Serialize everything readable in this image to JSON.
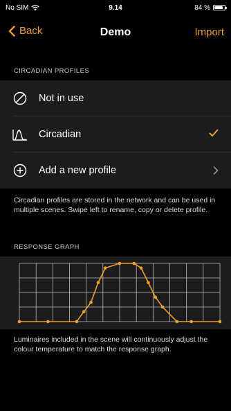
{
  "status": {
    "carrier": "No SIM",
    "time": "9.14",
    "battery_percent": "84 %",
    "battery_level": 0.84
  },
  "nav": {
    "back_label": "Back",
    "title": "Demo",
    "action_label": "Import"
  },
  "profiles": {
    "header": "CIRCADIAN PROFILES",
    "items": [
      {
        "label": "Not in use",
        "icon": "not-in-use-icon",
        "selected": false
      },
      {
        "label": "Circadian",
        "icon": "circadian-curve-icon",
        "selected": true
      },
      {
        "label": "Add a new profile",
        "icon": "add-circle-icon",
        "selected": false
      }
    ],
    "footer": "Circadian profiles are stored in the network and can be used in multiple scenes. Swipe left to rename, copy or delete profile."
  },
  "graph": {
    "header": "RESPONSE GRAPH",
    "footer": "Luminaires included in the scene will continuously adjust the colour temperature to match the response graph."
  },
  "colors": {
    "accent": "#f0a020",
    "background": "#000000",
    "cell": "#1c1c1e"
  },
  "chart_data": {
    "type": "line",
    "x": [
      0,
      2,
      4,
      4.5,
      5,
      5.5,
      6,
      7,
      8,
      8.5,
      9,
      9.5,
      10,
      11,
      12,
      14
    ],
    "y": [
      0,
      0,
      0,
      0.17,
      0.33,
      0.67,
      0.92,
      1,
      1,
      0.92,
      0.67,
      0.42,
      0.25,
      0,
      0,
      0
    ],
    "xlim": [
      0,
      14
    ],
    "ylim": [
      0,
      1
    ],
    "grid": true,
    "title": "",
    "xlabel": "",
    "ylabel": ""
  }
}
